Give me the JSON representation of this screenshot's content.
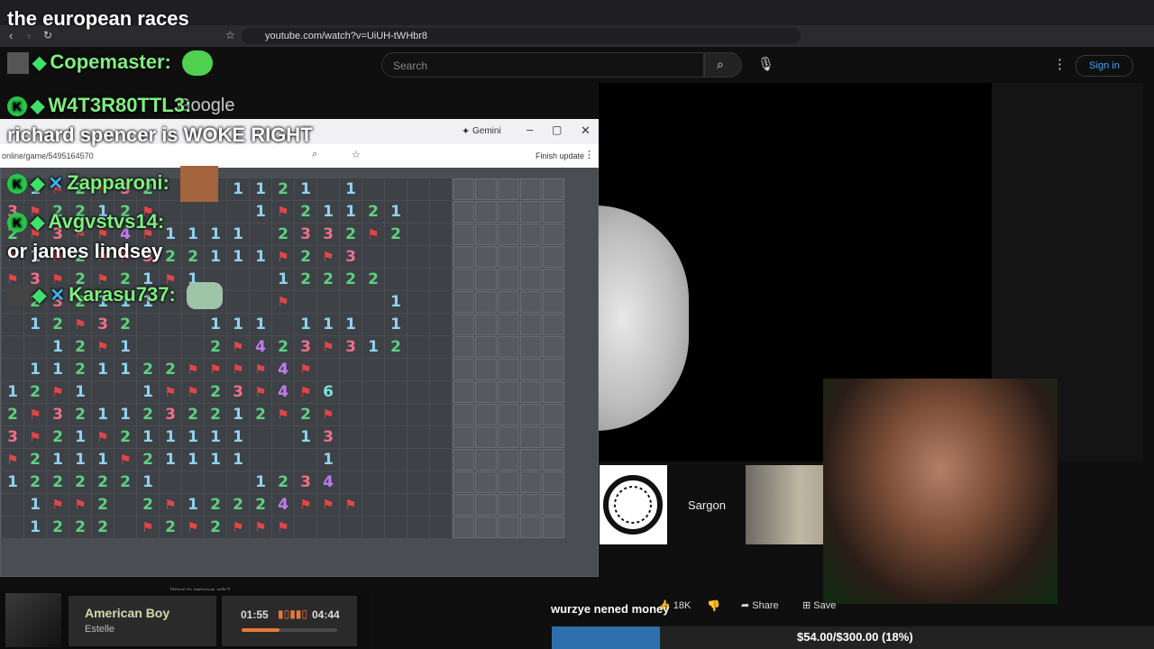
{
  "stream": {
    "title": "the european races",
    "goal_text": "$54.00/$300.00 (18%)",
    "goal_progress": 0.18,
    "ticker_text": "wurzye nened money"
  },
  "browser": {
    "url": "youtube.com/watch?v=UiUH-tWHbr8"
  },
  "youtube": {
    "search_placeholder": "Search",
    "sign_in": "Sign in",
    "likes": "18K",
    "share": "Share",
    "save": "Save",
    "channel_name": "Sargon"
  },
  "game_window": {
    "tab_title": "Gemini",
    "address": "online/game/5495164570",
    "finish_update": "Finish update",
    "ad_text": "Want to remove ads?",
    "google_text": "Google"
  },
  "chat": [
    {
      "user": "Copemaster:",
      "message": ""
    },
    {
      "user": "W4T3R80TTL3:",
      "message": ""
    },
    {
      "user": "",
      "message": "richard spencer is WOKE RIGHT"
    },
    {
      "user": "Zapparoni:",
      "message": ""
    },
    {
      "user": "Avgvstvs14:",
      "message": ""
    },
    {
      "user": "",
      "message": "or james lindsey"
    },
    {
      "user": "Karasu737:",
      "message": ""
    }
  ],
  "music": {
    "song": "American Boy",
    "artist": "Estelle",
    "elapsed": "01:55",
    "duration": "04:44",
    "progress": 0.4
  },
  "board_rows": [
    ".1F2F32...1121.1....",
    "3F2212F....1F21121..",
    "2F3FF4F1111.2332F2..",
    "F1F2FF322111F2F3....",
    "F3F2F21F1...12222...",
    "1232111.....F....1..",
    ".12F32...111.111.1..",
    "..12F1...2F423F312..",
    ".1121122FFFF4F......",
    "12F1..1FF23F4F6.....",
    "2F3211232212F2F.....",
    "3F21F211111..13.....",
    "F2111F21111...1.....",
    "1222221....1234.....",
    ".1FF2.2F12224FFF....",
    ".1222.F2F2FFF......."
  ]
}
